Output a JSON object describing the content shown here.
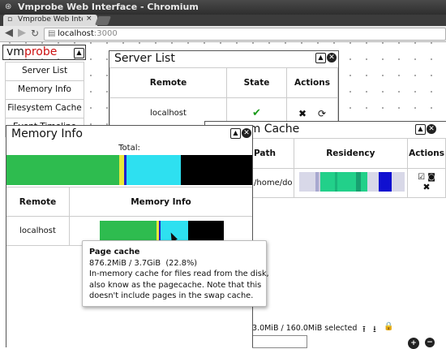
{
  "browser": {
    "window_title": "Vmprobe Web Interface - Chromium",
    "tab_title": "Vmprobe Web Interface",
    "tab_close": "×",
    "url_host": "localhost",
    "url_port": ":3000"
  },
  "sidebar": {
    "logo_vm": "vm",
    "logo_probe": "probe",
    "items": [
      {
        "label": "Server List"
      },
      {
        "label": "Memory Info"
      },
      {
        "label": "Filesystem Cache"
      },
      {
        "label": "Event Timeline"
      }
    ]
  },
  "server_list": {
    "title": "Server List",
    "columns": [
      "Remote",
      "State",
      "Actions"
    ],
    "rows": [
      {
        "remote": "localhost",
        "state_icon": "check-icon",
        "actions": [
          "remove-icon",
          "refresh-icon"
        ]
      }
    ]
  },
  "fs_cache": {
    "title_visible": "em Cache",
    "columns": [
      "Path",
      "Residency",
      "Actions"
    ],
    "row_path": "/home/do",
    "selected_text": "3.0MiB / 160.0MiB selected"
  },
  "memory_info": {
    "title": "Memory Info",
    "total_label": "Total:",
    "columns": [
      "Remote",
      "Memory Info"
    ],
    "row_remote": "localhost",
    "segments": [
      {
        "name": "used",
        "fraction": 0.46,
        "color": "#2ebc4f"
      },
      {
        "name": "buffers",
        "fraction": 0.02,
        "color": "#e8e83a"
      },
      {
        "name": "page-cache",
        "fraction": 0.01,
        "color": "#2222cc"
      },
      {
        "name": "swap-cache",
        "fraction": 0.22,
        "color": "#2ee0f0"
      },
      {
        "name": "free",
        "fraction": 0.29,
        "color": "#000000"
      }
    ]
  },
  "tooltip": {
    "title": "Page cache",
    "size_line": "876.2MiB / 3.7GiB  (22.8%)",
    "desc_1": "In-memory cache for files read from the disk,",
    "desc_2": "also know as the pagecache. Note that this",
    "desc_3": "doesn't include pages in the swap cache."
  }
}
